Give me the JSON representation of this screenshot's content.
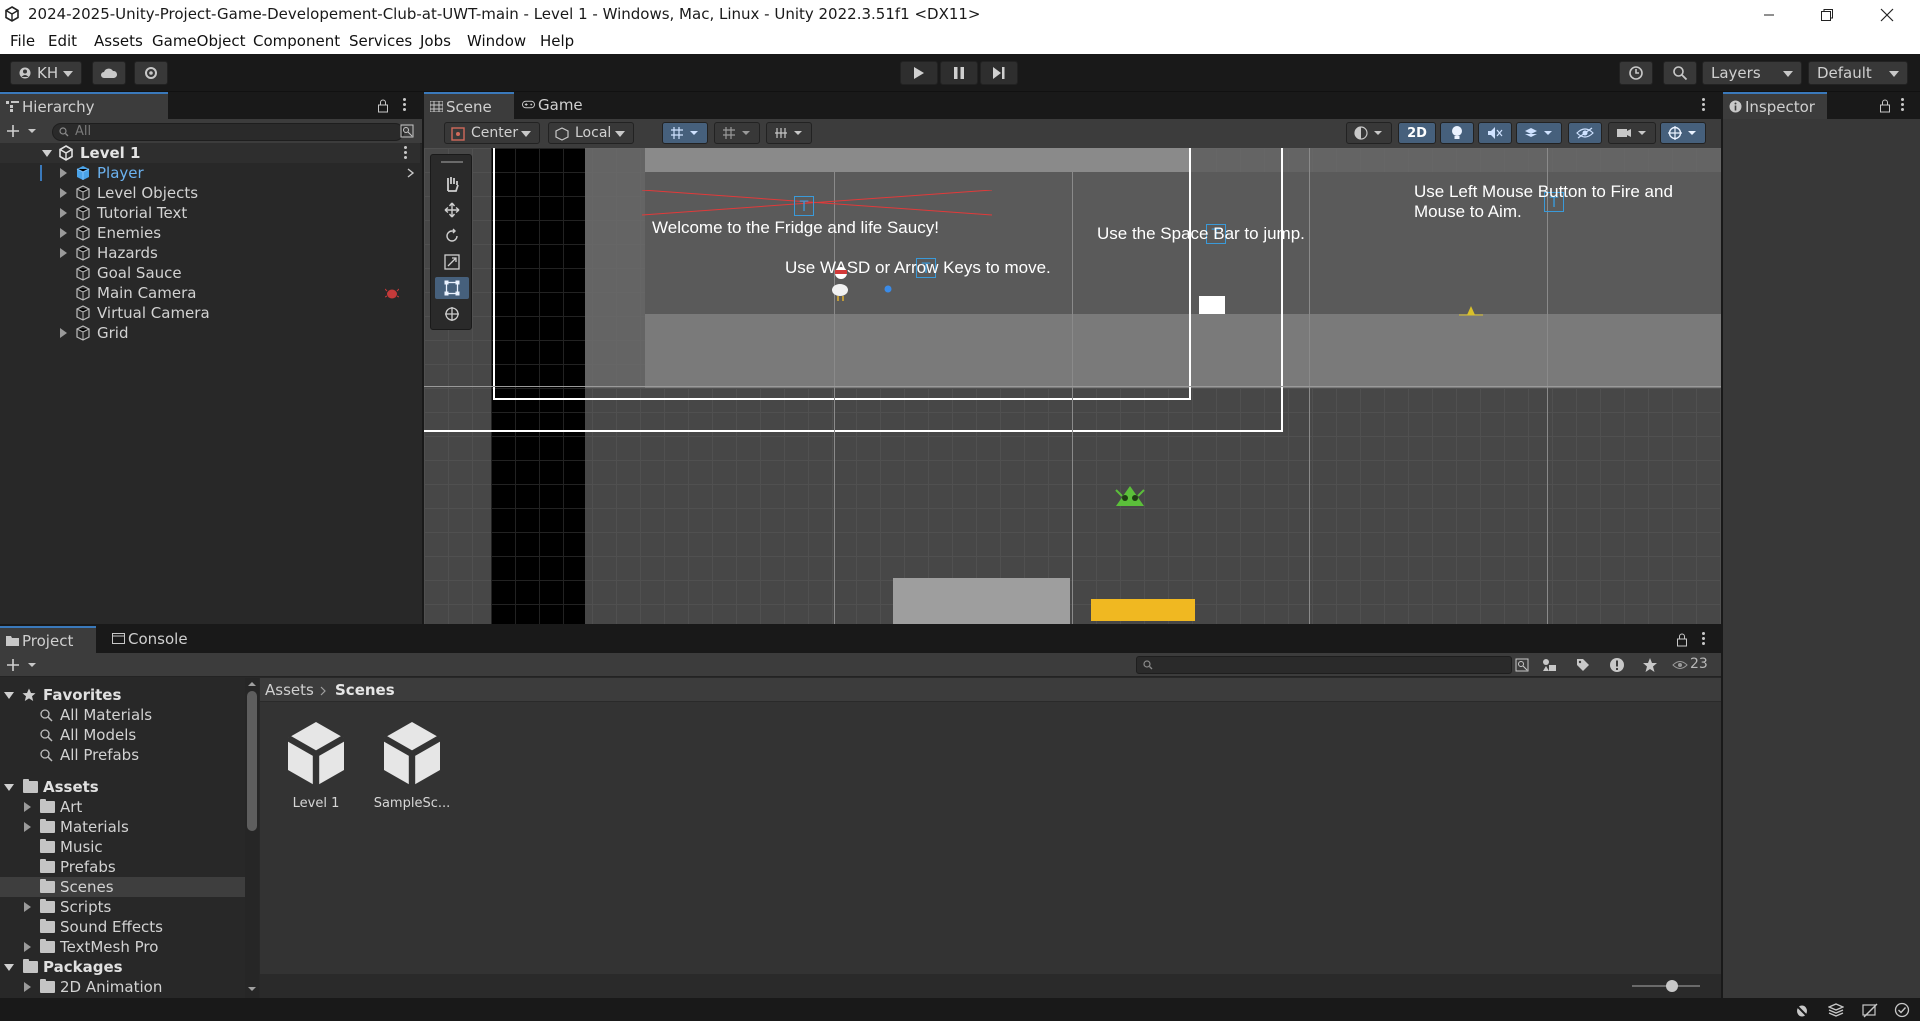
{
  "window": {
    "title": "2024-2025-Unity-Project-Game-Developement-Club-at-UWT-main - Level 1 - Windows, Mac, Linux - Unity 2022.3.51f1 <DX11>"
  },
  "menu": [
    "File",
    "Edit",
    "Assets",
    "GameObject",
    "Component",
    "Services",
    "Jobs",
    "Window",
    "Help"
  ],
  "toolbar": {
    "account": "KH",
    "layers": "Layers",
    "layout": "Default"
  },
  "hierarchy": {
    "tab": "Hierarchy",
    "search_placeholder": "All",
    "scene": "Level 1",
    "items": [
      "Player",
      "Level Objects",
      "Tutorial Text",
      "Enemies",
      "Hazards",
      "Goal Sauce",
      "Main Camera",
      "Virtual Camera",
      "Grid"
    ]
  },
  "scene_view": {
    "tabs": [
      "Scene",
      "Game"
    ],
    "pivot": "Center",
    "space": "Local",
    "mode_2d": "2D",
    "texts": {
      "welcome": "Welcome to the Fridge and life Saucy!",
      "move": "Use WASD or Arrow Keys to move.",
      "jump": "Use the Space Bar to jump.",
      "fire_line1": "Use Left Mouse Button to Fire and",
      "fire_line2": "Mouse to Aim."
    }
  },
  "inspector": {
    "tab": "Inspector"
  },
  "project": {
    "tabs": [
      "Project",
      "Console"
    ],
    "hidden_count": "23",
    "breadcrumb": [
      "Assets",
      "Scenes"
    ],
    "favorites_label": "Favorites",
    "favorites": [
      "All Materials",
      "All Models",
      "All Prefabs"
    ],
    "assets_label": "Assets",
    "assets_folders": [
      "Art",
      "Materials",
      "Music",
      "Prefabs",
      "Scenes",
      "Scripts",
      "Sound Effects",
      "TextMesh Pro"
    ],
    "packages_label": "Packages",
    "packages_folders": [
      "2D Animation"
    ],
    "files": [
      "Level 1",
      "SampleSc..."
    ]
  }
}
